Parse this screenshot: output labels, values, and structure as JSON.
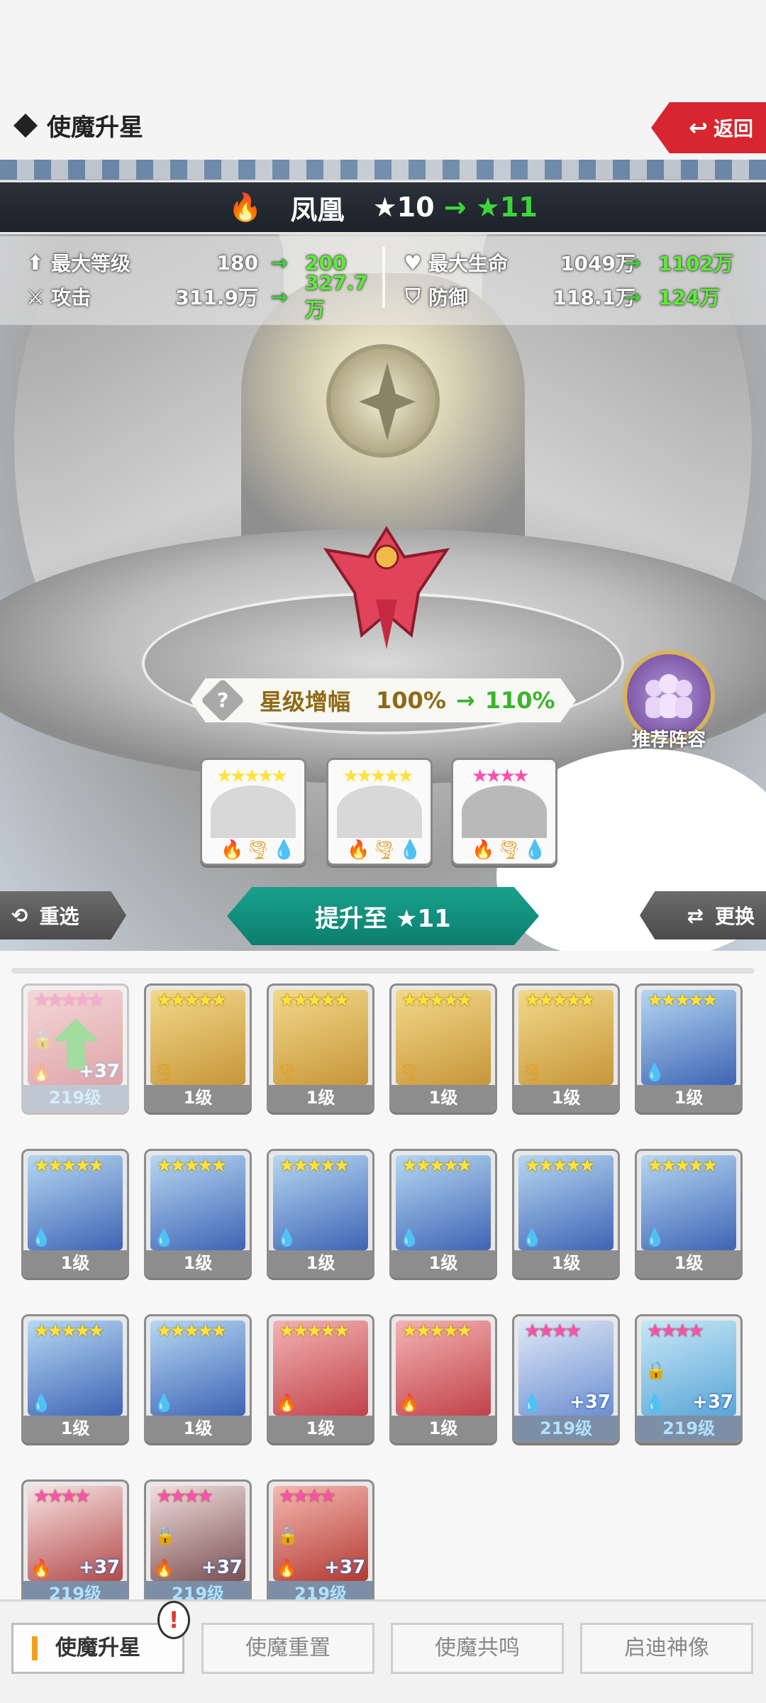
{
  "header": {
    "title": "使魔升星",
    "back_label": "返回"
  },
  "pet": {
    "name": "凤凰",
    "star_from": "★10",
    "arrow": "→",
    "star_to": "★11"
  },
  "stats": {
    "max_level": {
      "label": "最大等级",
      "from": "180",
      "to": "200"
    },
    "attack": {
      "label": "攻击",
      "from": "311.9万",
      "to": "327.7万"
    },
    "max_hp": {
      "label": "最大生命",
      "from": "1049万",
      "to": "1102万"
    },
    "defense": {
      "label": "防御",
      "from": "118.1万",
      "to": "124万"
    },
    "arrow": "→"
  },
  "star_gain": {
    "icon": "?",
    "label": "星级增幅",
    "from": "100%",
    "arrow": "→",
    "to": "110%"
  },
  "recommend_label": "推荐阵容",
  "material_slots": [
    {
      "stars": "★★★★★",
      "star_color": "#ffe23a"
    },
    {
      "stars": "★★★★★",
      "star_color": "#ffe23a"
    },
    {
      "stars": "★★★★",
      "star_color": "#ff4fb0"
    }
  ],
  "actions": {
    "reselect_label": "重选",
    "upgrade_label": "提升至 ★11",
    "change_label": "更换"
  },
  "inventory": [
    {
      "stars": "★★★★★",
      "star_color": "p",
      "type": "red",
      "element": "fire",
      "level": "219级",
      "plus": "+37",
      "locked": true,
      "selected": true
    },
    {
      "stars": "★★★★★",
      "star_color": "y",
      "type": "gold",
      "element": "wind",
      "level": "1级"
    },
    {
      "stars": "★★★★★",
      "star_color": "y",
      "type": "gold",
      "element": "wind",
      "level": "1级"
    },
    {
      "stars": "★★★★★",
      "star_color": "y",
      "type": "gold",
      "element": "wind",
      "level": "1级"
    },
    {
      "stars": "★★★★★",
      "star_color": "y",
      "type": "gold",
      "element": "wind",
      "level": "1级"
    },
    {
      "stars": "★★★★★",
      "star_color": "y",
      "type": "blue",
      "element": "water",
      "level": "1级"
    },
    {
      "stars": "★★★★★",
      "star_color": "y",
      "type": "blue",
      "element": "water",
      "level": "1级"
    },
    {
      "stars": "★★★★★",
      "star_color": "y",
      "type": "blue",
      "element": "water",
      "level": "1级"
    },
    {
      "stars": "★★★★★",
      "star_color": "y",
      "type": "blue",
      "element": "water",
      "level": "1级"
    },
    {
      "stars": "★★★★★",
      "star_color": "y",
      "type": "blue",
      "element": "water",
      "level": "1级"
    },
    {
      "stars": "★★★★★",
      "star_color": "y",
      "type": "blue",
      "element": "water",
      "level": "1级"
    },
    {
      "stars": "★★★★★",
      "star_color": "y",
      "type": "blue",
      "element": "water",
      "level": "1级"
    },
    {
      "stars": "★★★★★",
      "star_color": "y",
      "type": "blue",
      "element": "water",
      "level": "1级"
    },
    {
      "stars": "★★★★★",
      "star_color": "y",
      "type": "blue",
      "element": "water",
      "level": "1级"
    },
    {
      "stars": "★★★★★",
      "star_color": "y",
      "type": "red",
      "element": "fire",
      "level": "1级"
    },
    {
      "stars": "★★★★★",
      "star_color": "y",
      "type": "red",
      "element": "fire",
      "level": "1级"
    },
    {
      "stars": "★★★★",
      "star_color": "p",
      "type": "wiz",
      "element": "water",
      "level": "219级",
      "plus": "+37"
    },
    {
      "stars": "★★★★",
      "star_color": "p",
      "type": "drg",
      "element": "water",
      "level": "219级",
      "plus": "+37",
      "locked": true
    },
    {
      "stars": "★★★★",
      "star_color": "p",
      "type": "pnd",
      "element": "fire",
      "level": "219级",
      "plus": "+37"
    },
    {
      "stars": "★★★★",
      "star_color": "p",
      "type": "gst",
      "element": "fire",
      "level": "219级",
      "plus": "+37",
      "locked": true
    },
    {
      "stars": "★★★★",
      "star_color": "p",
      "type": "dmn",
      "element": "fire",
      "level": "219级",
      "plus": "+37",
      "locked": true
    }
  ],
  "tabs": [
    {
      "label": "使魔升星",
      "active": true
    },
    {
      "label": "使魔重置"
    },
    {
      "label": "使魔共鸣"
    },
    {
      "label": "启迪神像"
    }
  ],
  "alert_icon": "!",
  "colors": {
    "accent_green": "#3ed43a",
    "back_red": "#d7262f",
    "upgrade_teal": "#12907c",
    "tab_accent": "#f0a11c"
  }
}
